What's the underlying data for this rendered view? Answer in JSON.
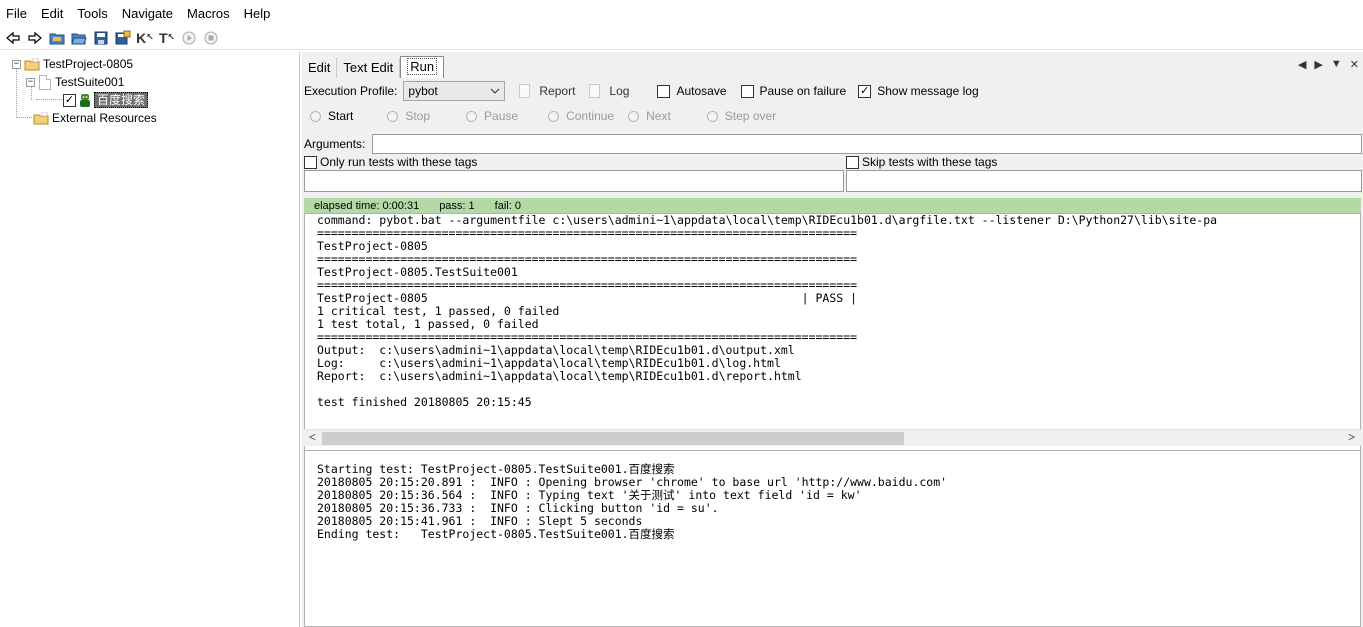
{
  "menu": [
    "File",
    "Edit",
    "Tools",
    "Navigate",
    "Macros",
    "Help"
  ],
  "toolbar_icons": [
    "back-arrow-icon",
    "forward-arrow-icon",
    "open-suite-icon",
    "open-directory-icon",
    "save-icon",
    "save-all-icon",
    "search-keywords-icon",
    "search-tests-icon",
    "run-icon",
    "stop-icon"
  ],
  "toolbar_k": "K",
  "toolbar_t": "T",
  "tree": {
    "project": "TestProject-0805",
    "suite": "TestSuite001",
    "test": "百度搜索",
    "external": "External Resources"
  },
  "tabs": [
    "Edit",
    "Text Edit",
    "Run"
  ],
  "tab_nav": {
    "left": "◀",
    "right": "▶",
    "list": "▼",
    "close": "✕"
  },
  "run": {
    "profile_label": "Execution Profile:",
    "profile_value": "pybot",
    "report_label": "Report",
    "log_label": "Log",
    "autosave_label": "Autosave",
    "pause_on_failure_label": "Pause on failure",
    "show_message_log_label": "Show message log",
    "show_message_log_checked": true,
    "start_label": "Start",
    "stop_label": "Stop",
    "pause_label": "Pause",
    "continue_label": "Continue",
    "next_label": "Next",
    "step_over_label": "Step over",
    "arguments_label": "Arguments:",
    "only_run_tags_label": "Only run tests with these tags",
    "skip_tags_label": "Skip tests with these tags"
  },
  "status": {
    "elapsed": "elapsed time: 0:00:31",
    "pass": "pass: 1",
    "fail": "fail: 0",
    "color": "#b3d9a6"
  },
  "console_lines": [
    "command: pybot.bat --argumentfile c:\\users\\admini~1\\appdata\\local\\temp\\RIDEcu1b01.d\\argfile.txt --listener D:\\Python27\\lib\\site-pa",
    "==============================================================================",
    "TestProject-0805",
    "==============================================================================",
    "TestProject-0805.TestSuite001",
    "==============================================================================",
    "TestProject-0805                                                      | PASS |",
    "1 critical test, 1 passed, 0 failed",
    "1 test total, 1 passed, 0 failed",
    "==============================================================================",
    "Output:  c:\\users\\admini~1\\appdata\\local\\temp\\RIDEcu1b01.d\\output.xml",
    "Log:     c:\\users\\admini~1\\appdata\\local\\temp\\RIDEcu1b01.d\\log.html",
    "Report:  c:\\users\\admini~1\\appdata\\local\\temp\\RIDEcu1b01.d\\report.html",
    "",
    "test finished 20180805 20:15:45"
  ],
  "message_log_lines": [
    "Starting test: TestProject-0805.TestSuite001.百度搜索",
    "20180805 20:15:20.891 :  INFO : Opening browser 'chrome' to base url 'http://www.baidu.com'",
    "20180805 20:15:36.564 :  INFO : Typing text '关于测试' into text field 'id = kw'",
    "20180805 20:15:36.733 :  INFO : Clicking button 'id = su'.",
    "20180805 20:15:41.961 :  INFO : Slept 5 seconds",
    "Ending test:   TestProject-0805.TestSuite001.百度搜索"
  ],
  "scroll_arrows": {
    "left": "<",
    "right": ">"
  }
}
